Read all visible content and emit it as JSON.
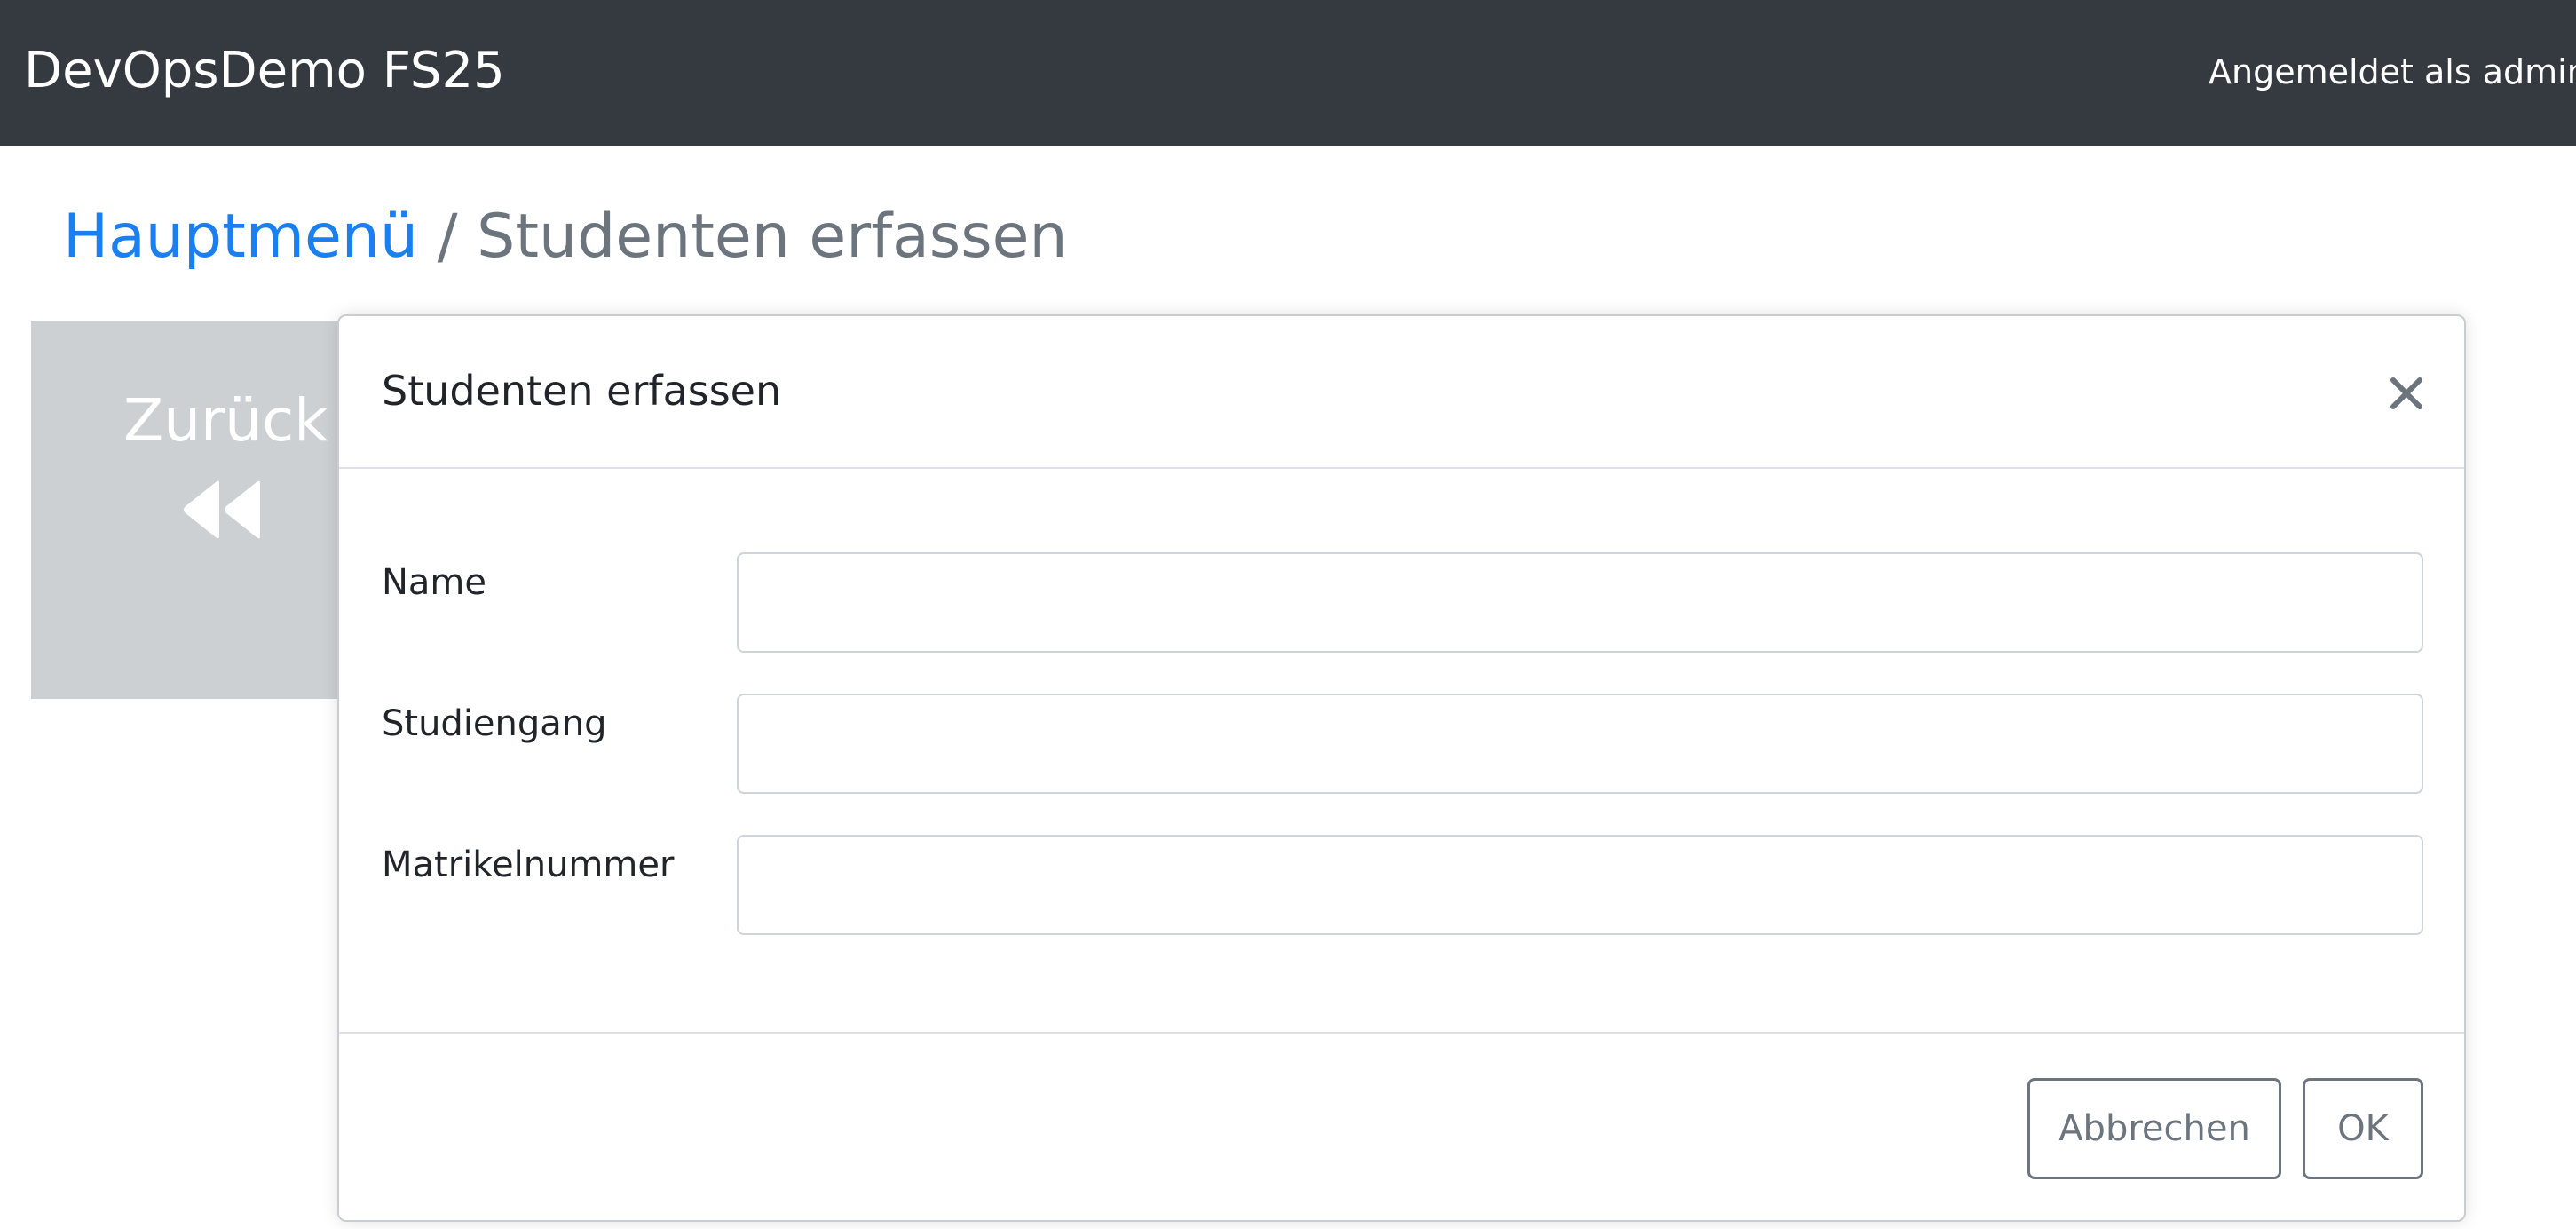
{
  "navbar": {
    "brand": "DevOpsDemo FS25",
    "user_info": "Angemeldet als admin"
  },
  "breadcrumb": {
    "home": "Hauptmenü",
    "separator": "/",
    "current": "Studenten erfassen"
  },
  "back_tile": {
    "label": "Zurück",
    "icon": "backward-double-icon"
  },
  "modal": {
    "title": "Studenten erfassen",
    "close_icon": "close-icon",
    "fields": [
      {
        "label": "Name",
        "value": "",
        "placeholder": ""
      },
      {
        "label": "Studiengang",
        "value": "",
        "placeholder": ""
      },
      {
        "label": "Matrikelnummer",
        "value": "",
        "placeholder": ""
      }
    ],
    "cancel_label": "Abbrechen",
    "ok_label": "OK"
  },
  "colors": {
    "navbar_bg": "#343a40",
    "link": "#1a7ff0",
    "muted": "#6c757d",
    "tile_bg": "#cdd0d3"
  }
}
